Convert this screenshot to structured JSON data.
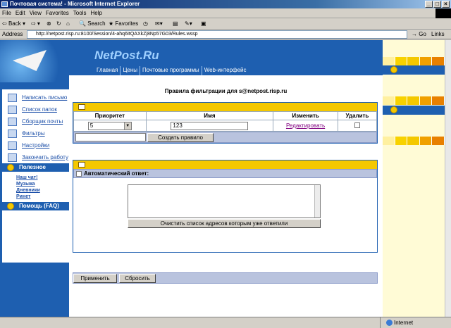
{
  "window": {
    "title": "Почтовая система! - Microsoft Internet Explorer"
  },
  "menu": [
    "File",
    "Edit",
    "View",
    "Favorites",
    "Tools",
    "Help"
  ],
  "toolbar": {
    "back": "Back",
    "search": "Search",
    "favorites": "Favorites"
  },
  "address": {
    "label": "Address",
    "url": "http://netpost.risp.ru:8100/Session/4-ahq6ItQAXkZj8Np57G03/Rules.wssp",
    "go": "Go",
    "links": "Links"
  },
  "status": {
    "zone": "Internet"
  },
  "site": {
    "brand": "NetPost.Ru",
    "nav": [
      "Главная",
      "Цены",
      "Почтовые программы",
      "Web-интерфейс"
    ]
  },
  "sidebar": {
    "items": [
      {
        "label": "Написать письмо",
        "icon": "compose-icon"
      },
      {
        "label": "Список папок",
        "icon": "folders-icon"
      },
      {
        "label": "Сборщик почты",
        "icon": "collector-icon"
      },
      {
        "label": "Фильтры",
        "icon": "filter-icon"
      },
      {
        "label": "Настройки",
        "icon": "settings-icon"
      },
      {
        "label": "Закончить работу",
        "icon": "logout-icon"
      }
    ],
    "useful_header": "Полезное",
    "useful_links": [
      "Наш чат!",
      "Музыка",
      "Дневники",
      "Ринет"
    ],
    "help_header": "Помощь (FAQ)"
  },
  "page": {
    "title": "Правила фильтрации для s@netpost.risp.ru",
    "table": {
      "headers": [
        "Приоритет",
        "Имя",
        "Изменить",
        "Удалить"
      ],
      "row": {
        "priority": "5",
        "name": "123",
        "edit": "Редактировать"
      }
    },
    "create_button": "Создать правило",
    "auto_reply_label": "Автоматический ответ:",
    "clear_button": "Очистить список адресов которым уже ответили",
    "apply_button": "Применить",
    "reset_button": "Сбросить"
  },
  "colors": {
    "brand_blue": "#1e5fb0",
    "accent_yellow": "#f4c800"
  }
}
